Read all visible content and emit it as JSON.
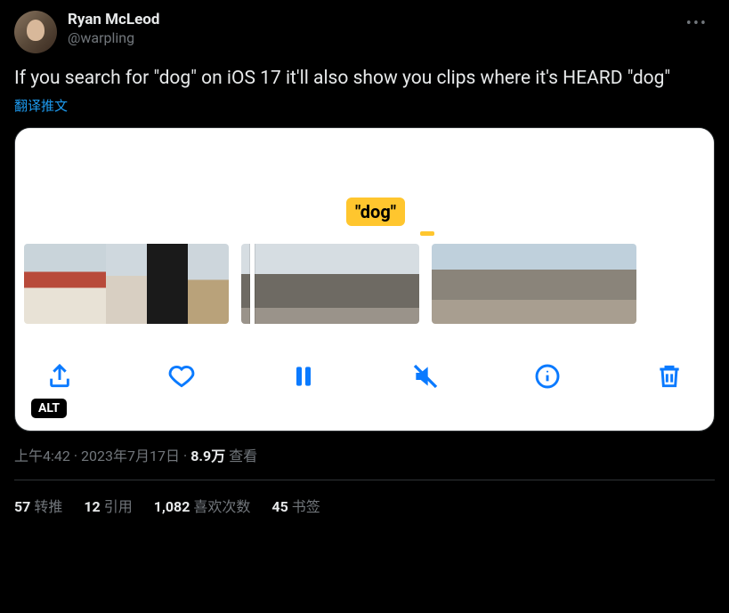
{
  "author": {
    "display_name": "Ryan McLeod",
    "handle": "@warpling"
  },
  "more_label": "•••",
  "body_text": "If you search for \"dog\" on iOS 17 it'll also show you clips where it's HEARD \"dog\"",
  "translate_label": "翻译推文",
  "media": {
    "dog_tag": "\"dog\"",
    "alt_badge": "ALT",
    "toolbar": {
      "share": "share",
      "heart": "heart",
      "pause": "pause",
      "mute": "mute",
      "info": "info",
      "trash": "trash"
    }
  },
  "meta": {
    "time": "上午4:42",
    "date": "2023年7月17日",
    "views_count": "8.9万",
    "views_label": " 查看"
  },
  "stats": {
    "retweets": {
      "count": "57",
      "label": "转推"
    },
    "quotes": {
      "count": "12",
      "label": "引用"
    },
    "likes": {
      "count": "1,082",
      "label": "喜欢次数"
    },
    "bookmarks": {
      "count": "45",
      "label": "书签"
    }
  }
}
